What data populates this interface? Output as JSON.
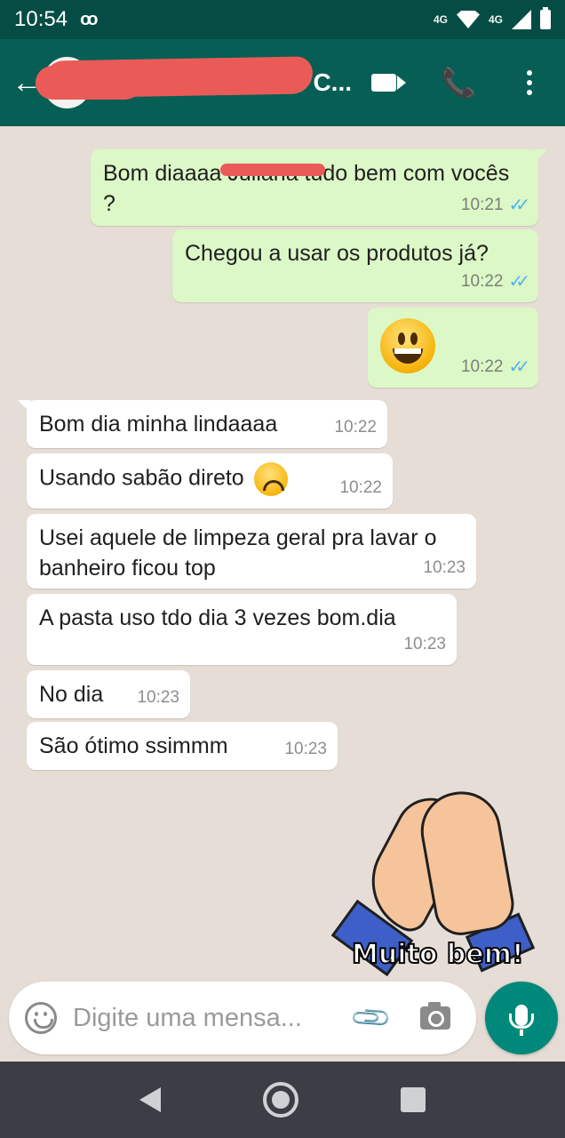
{
  "status_bar": {
    "time": "10:54",
    "voicemail_icon": "oo",
    "network_label_1": "4G",
    "network_label_2": "4G"
  },
  "header": {
    "contact_name": "C...",
    "icons": [
      "back-arrow-icon",
      "avatar",
      "video-call-icon",
      "phone-icon",
      "more-vert-icon"
    ]
  },
  "messages": [
    {
      "direction": "out",
      "text": "Bom diaaaa Juliana tudo bem com vocês ?",
      "time": "10:21",
      "ticks": "✓✓"
    },
    {
      "direction": "out",
      "text": "Chegou a usar os produtos já?",
      "time": "10:22",
      "ticks": "✓✓"
    },
    {
      "direction": "out",
      "text": "😀",
      "time": "10:22",
      "ticks": "✓✓"
    },
    {
      "direction": "in",
      "text": "Bom dia minha lindaaaa",
      "time": "10:22"
    },
    {
      "direction": "in",
      "text": "Usando sabão direto",
      "time": "10:22"
    },
    {
      "direction": "in",
      "text": "Usei aquele de limpeza geral pra lavar o banheiro ficou top",
      "time": "10:23"
    },
    {
      "direction": "in",
      "text": "A pasta uso tdo dia 3 vezes bom.dia",
      "time": "10:23"
    },
    {
      "direction": "in",
      "text": "No dia",
      "time": "10:23"
    },
    {
      "direction": "in",
      "text": "São ótimo ssimmm",
      "time": "10:23"
    }
  ],
  "sticker": {
    "text": "Muito bem!"
  },
  "input": {
    "placeholder": "Digite uma mensa..."
  },
  "colors": {
    "header": "#075e54",
    "status_bar": "#054d44",
    "outgoing_bubble": "#dcf8c6",
    "incoming_bubble": "#ffffff",
    "read_ticks": "#4fb5eb",
    "mic_button": "#00897b"
  }
}
